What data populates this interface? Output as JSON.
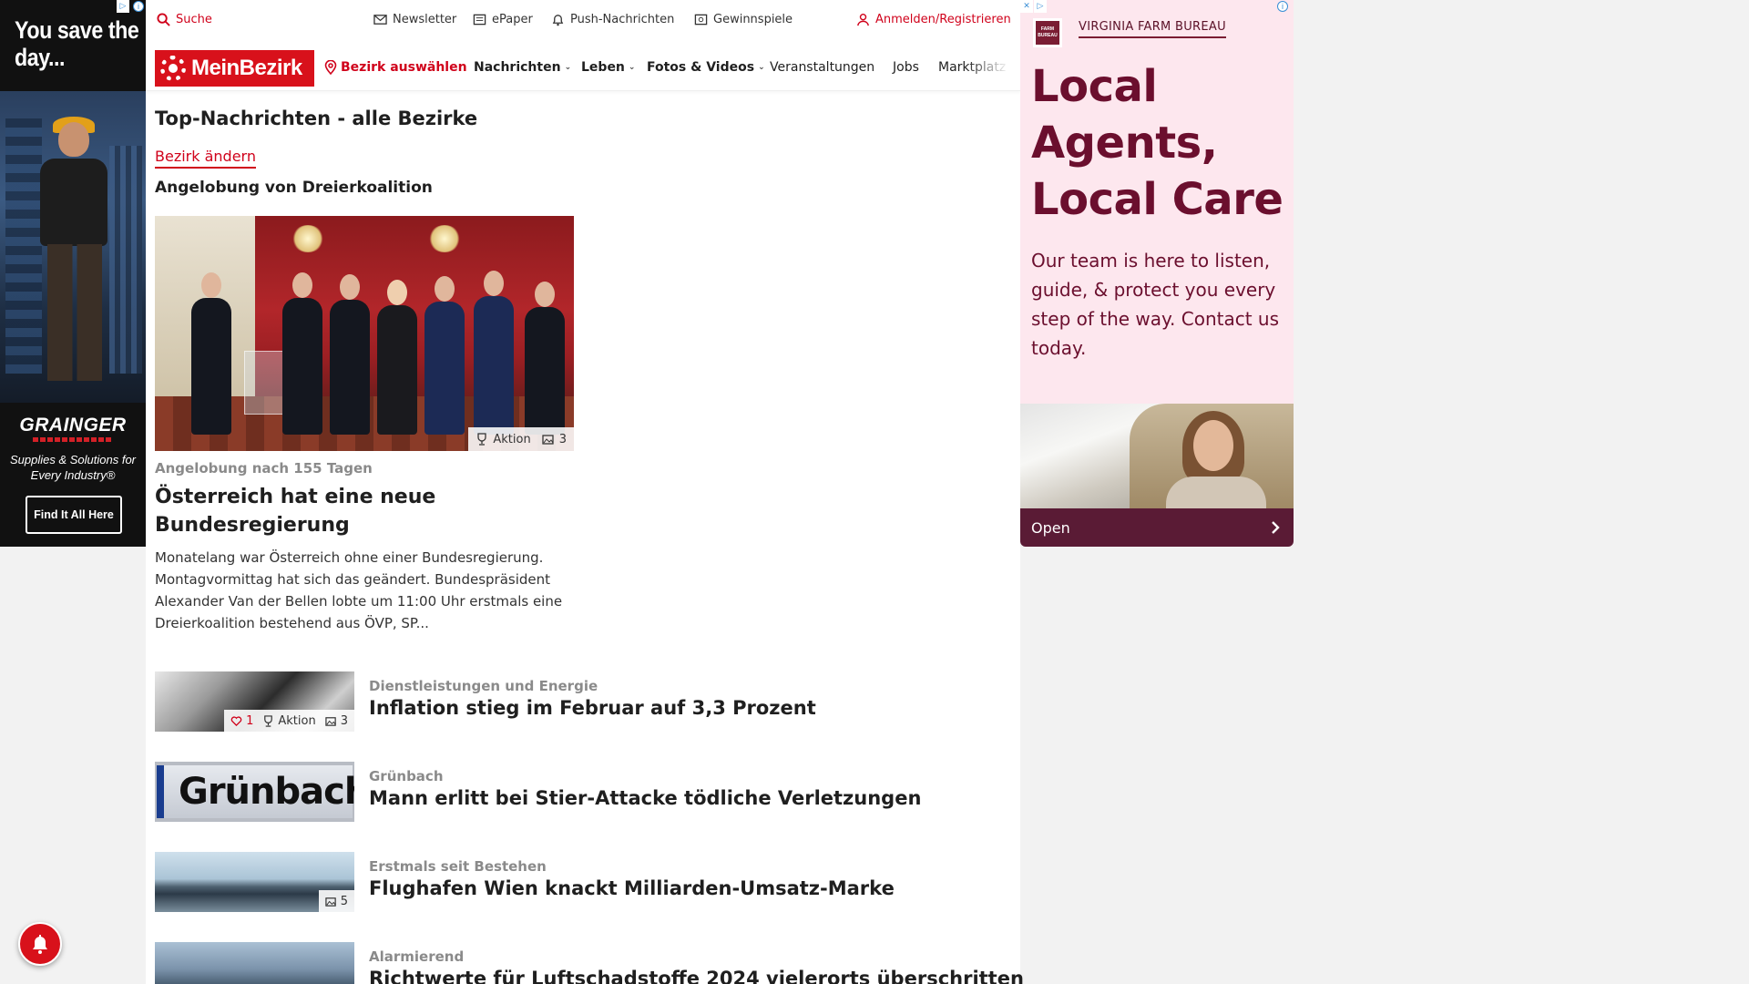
{
  "left_ad": {
    "headline": "You save the day...",
    "brand": "GRAINGER",
    "tagline": "Supplies & Solutions for Every Industry®",
    "cta": "Find It All Here"
  },
  "util": {
    "search": "Suche",
    "newsletter": "Newsletter",
    "epaper": "ePaper",
    "push": "Push-Nachrichten",
    "contests": "Gewinnspiele",
    "login": "Anmelden/Registrieren"
  },
  "nav": {
    "logo": "MeinBezirk",
    "district": "Bezirk auswählen",
    "items": [
      "Nachrichten",
      "Leben",
      "Fotos & Videos",
      "Veranstaltungen",
      "Jobs",
      "Marktplatz"
    ]
  },
  "page": {
    "title": "Top-Nachrichten - alle Bezirke",
    "change_district": "Bezirk ändern",
    "section": "Angelobung von Dreierkoalition"
  },
  "hero": {
    "badge_action": "Aktion",
    "badge_photos": "3",
    "kicker": "Angelobung nach 155 Tagen",
    "headline": "Österreich hat eine neue Bundesregierung",
    "teaser": "Monatelang war Österreich ohne einer Bundesregierung. Montagvormittag hat sich das geändert. Bundespräsident Alexander Van der Bellen lobte um 11:00 Uhr erstmals eine Dreierkoalition bestehend aus ÖVP, SP..."
  },
  "articles": [
    {
      "kicker": "Dienstleistungen und Energie",
      "headline": "Inflation stieg im Februar auf 3,3 Prozent",
      "likes": "1",
      "action": "Aktion",
      "photos": "3"
    },
    {
      "kicker": "Grünbach",
      "headline": "Mann erlitt bei Stier-Attacke tödliche Verletzungen",
      "sign": "Grünbach"
    },
    {
      "kicker": "Erstmals seit Bestehen",
      "headline": "Flughafen Wien knackt Milliarden-Umsatz-Marke",
      "photos": "5"
    },
    {
      "kicker": "Alarmierend",
      "headline": "Richtwerte für Luftschadstoffe 2024 vielerorts überschritten"
    }
  ],
  "right_ad": {
    "org": "VIRGINIA FARM BUREAU",
    "logo_text": "FARM BUREAU",
    "headline": "Local Agents, Local Care",
    "body": "Our team is here to listen, guide, & protect you every step of the way. Contact us today.",
    "open": "Open"
  },
  "colors": {
    "brand_red": "#d8111b",
    "ad_maroon": "#6b0f2e",
    "ad_bg": "#fde7ee"
  }
}
